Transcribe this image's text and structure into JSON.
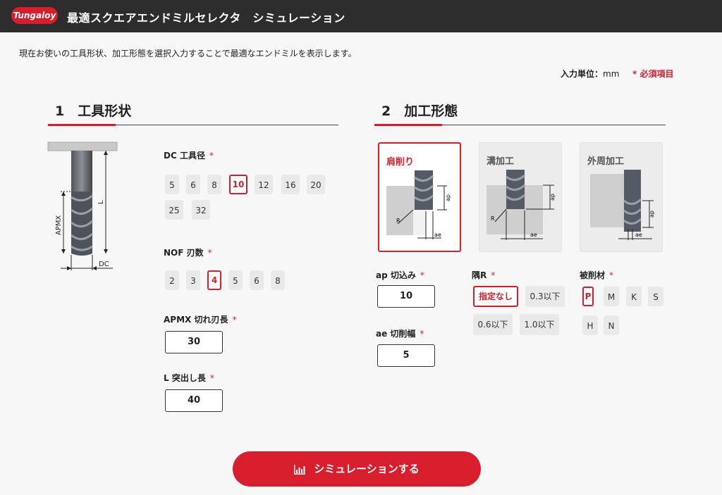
{
  "header": {
    "logo_text": "Tungaloy",
    "title": "最適スクエアエンドミルセレクタ　シミュレーション"
  },
  "intro_text": "現在お使いの工具形状、加工形態を選択入力することで最適なエンドミルを表示します。",
  "unit_label": "入力単位：",
  "unit_value": "mm",
  "required_label": "* 必須項目",
  "colors": {
    "accent": "#d81e2c",
    "header_bg": "#2d2d2d"
  },
  "section1": {
    "title": "1　工具形状",
    "illustration": {
      "label_apmx": "APMX",
      "label_l": "L",
      "label_dc": "DC"
    },
    "dc": {
      "label": "DC 工具径",
      "star": "*",
      "options": [
        "5",
        "6",
        "8",
        "10",
        "12",
        "16",
        "20",
        "25",
        "32"
      ],
      "selected": "10"
    },
    "nof": {
      "label": "NOF 刃数",
      "star": "*",
      "options": [
        "2",
        "3",
        "4",
        "5",
        "6",
        "8"
      ],
      "selected": "4"
    },
    "apmx": {
      "label": "APMX 切れ刃長",
      "star": "*",
      "value": "30"
    },
    "l": {
      "label": "L 突出し長",
      "star": "*",
      "value": "40"
    }
  },
  "section2": {
    "title": "2　加工形態",
    "cards": [
      {
        "label": "肩削り",
        "selected": true,
        "labels": {
          "ap": "ap",
          "ae": "ae",
          "r": "R"
        }
      },
      {
        "label": "溝加工",
        "selected": false,
        "labels": {
          "ap": "ap",
          "ae": "ae",
          "r": "R"
        }
      },
      {
        "label": "外周加工",
        "selected": false,
        "labels": {
          "ap": "ap",
          "ae": "ae"
        }
      }
    ],
    "ap": {
      "label": "ap 切込み",
      "star": "*",
      "value": "10"
    },
    "ae": {
      "label": "ae 切削幅",
      "star": "*",
      "value": "5"
    },
    "corner_r": {
      "label": "隅R",
      "star": "*",
      "options": [
        "指定なし",
        "0.3以下",
        "0.6以下",
        "1.0以下"
      ],
      "selected": "指定なし"
    },
    "material": {
      "label": "被削材",
      "star": "*",
      "options": [
        "P",
        "M",
        "K",
        "S",
        "H",
        "N"
      ],
      "selected": "P"
    }
  },
  "simulate_button": {
    "label": "シミュレーションする",
    "icon": "bar-chart-icon"
  }
}
